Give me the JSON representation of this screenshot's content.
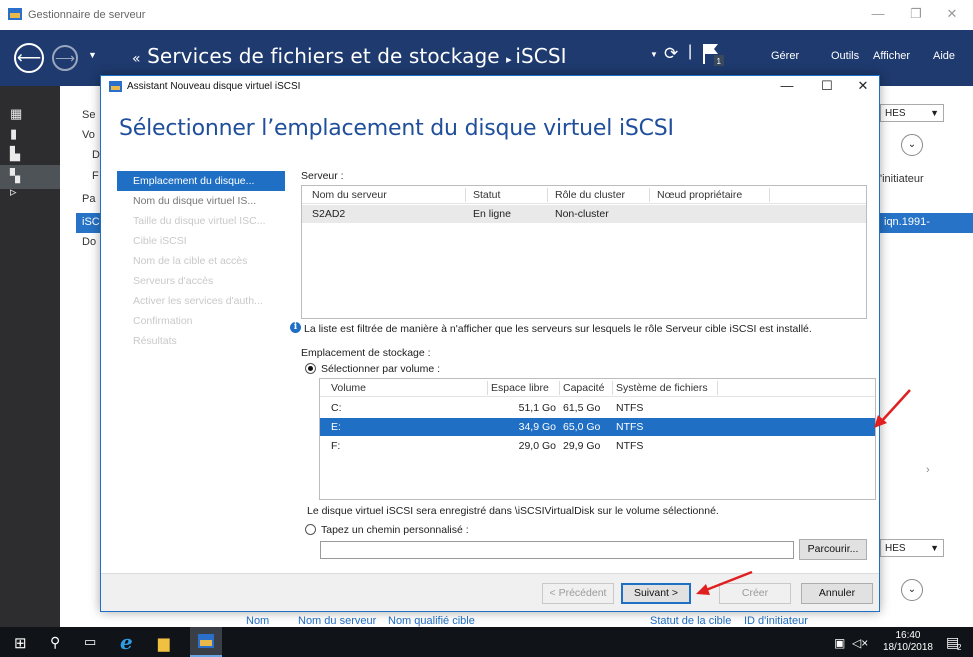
{
  "server_manager": {
    "title": "Gestionnaire de serveur",
    "breadcrumb_parent": "Services de fichiers et de stockage",
    "breadcrumb_current": "iSCSI",
    "menu": [
      "Gérer",
      "Outils",
      "Afficher",
      "Aide"
    ],
    "left_sidebar_partial": [
      "Se",
      "Vo",
      "D",
      "F",
      "Pa",
      "iSC",
      "Do"
    ],
    "right_partial": {
      "dropdown_1": "HES",
      "col_header": "'initiateur",
      "selected_value": "iqn.1991-",
      "dropdown_2": "HES"
    },
    "bottom_columns": [
      "Nom",
      "Nom du serveur",
      "Nom qualifié cible",
      "Statut de la cible",
      "ID d'initiateur"
    ]
  },
  "dialog": {
    "title": "Assistant Nouveau disque virtuel iSCSI",
    "header": "Sélectionner l’emplacement du disque virtuel iSCSI",
    "steps": [
      {
        "label": "Emplacement du disque...",
        "state": "active"
      },
      {
        "label": "Nom du disque virtuel IS...",
        "state": "done"
      },
      {
        "label": "Taille du disque virtuel ISC...",
        "state": "pending"
      },
      {
        "label": "Cible iSCSI",
        "state": "pending"
      },
      {
        "label": "Nom de la cible et accès",
        "state": "pending"
      },
      {
        "label": "Serveurs d'accès",
        "state": "pending"
      },
      {
        "label": "Activer les services d'auth...",
        "state": "pending"
      },
      {
        "label": "Confirmation",
        "state": "pending"
      },
      {
        "label": "Résultats",
        "state": "pending"
      }
    ],
    "server_label": "Serveur :",
    "server_table": {
      "columns": [
        "Nom du serveur",
        "Statut",
        "Rôle du cluster",
        "Nœud propriétaire"
      ],
      "rows": [
        [
          "S2AD2",
          "En ligne",
          "Non-cluster",
          ""
        ]
      ]
    },
    "info_text": "La liste est filtrée de manière à n'afficher que les serveurs sur lesquels le rôle Serveur cible iSCSI est installé.",
    "storage_label": "Emplacement de stockage :",
    "radio_volume": "Sélectionner par volume :",
    "volume_table": {
      "columns": [
        "Volume",
        "Espace libre",
        "Capacité",
        "Système de fichiers"
      ],
      "rows": [
        [
          "C:",
          "51,1 Go",
          "61,5 Go",
          "NTFS"
        ],
        [
          "E:",
          "34,9 Go",
          "65,0 Go",
          "NTFS"
        ],
        [
          "F:",
          "29,0 Go",
          "29,9 Go",
          "NTFS"
        ]
      ],
      "selected_index": 1
    },
    "save_note": "Le disque virtuel iSCSI sera enregistré dans \\iSCSIVirtualDisk sur le volume sélectionné.",
    "radio_path": "Tapez un chemin personnalisé :",
    "path_value": "",
    "browse_button": "Parcourir...",
    "buttons": {
      "previous": "< Précédent",
      "next": "Suivant >",
      "create": "Créer",
      "cancel": "Annuler"
    }
  },
  "taskbar": {
    "time": "16:40",
    "date": "18/10/2018",
    "notification_count": "2"
  },
  "colors": {
    "accent": "#1f6fc5",
    "nav_bg": "#1e3a6e",
    "annotation_arrow": "#e02020"
  }
}
